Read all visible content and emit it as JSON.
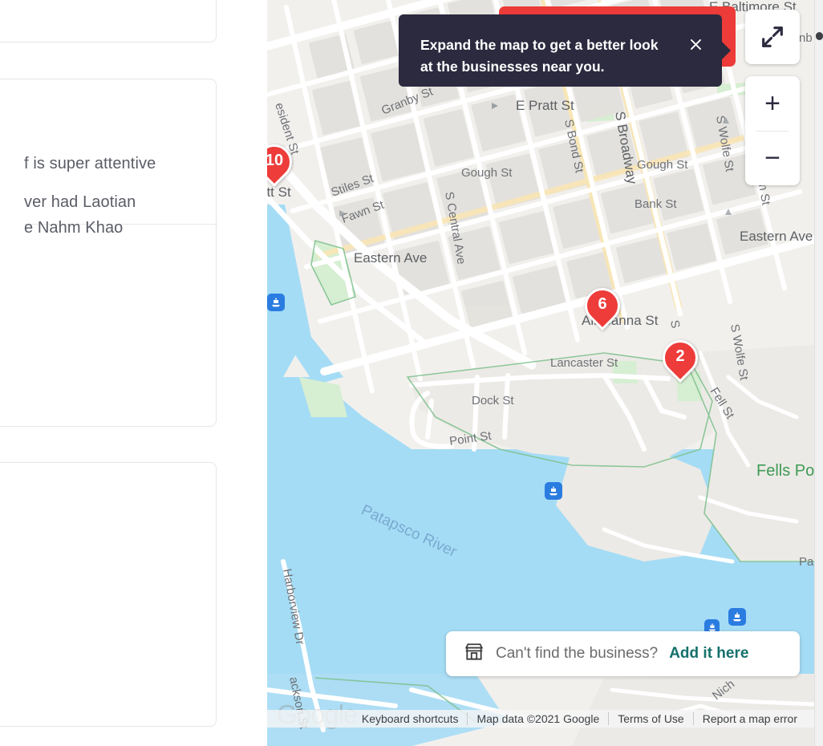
{
  "sidebar": {
    "cards": [
      {
        "id": "card-1",
        "text": ""
      },
      {
        "id": "card-2",
        "text": "f is super attentive"
      },
      {
        "id": "card-3",
        "text": "ver had Laotian\ne Nahm Khao"
      }
    ]
  },
  "tooltip": {
    "message": "Expand the map to get a better look at the businesses near you.",
    "close_icon": "close-icon"
  },
  "map_controls": {
    "expand_label": "expand-map",
    "expand_icon": "expand-arrows-icon",
    "zoom_in_label": "+",
    "zoom_out_label": "−"
  },
  "add_banner": {
    "icon": "storefront-icon",
    "prompt": "Can't find the business?",
    "link": "Add it here",
    "link_color": "#14706b"
  },
  "attribution": {
    "items": [
      "Keyboard shortcuts",
      "Map data ©2021 Google",
      "Terms of Use",
      "Report a map error"
    ]
  },
  "google_watermark": "Google",
  "map": {
    "markers": [
      {
        "id": "marker-10",
        "count": "10",
        "color": "#ed3c3a"
      },
      {
        "id": "marker-6",
        "count": "6",
        "color": "#ed3c3a"
      },
      {
        "id": "marker-2",
        "count": "2",
        "color": "#ed3c3a"
      }
    ],
    "transit_icons": [
      "ferry-icon",
      "ferry-icon",
      "ferry-icon",
      "ferry-icon"
    ],
    "street_labels": [
      "E Baltimore St",
      "E Pratt St",
      "Granby St",
      "Gough St",
      "Gough St",
      "Bank St",
      "S Bond St",
      "S Broadway",
      "S Wolfe St",
      "S Wolfe St",
      "President St",
      "Pratt St",
      "Stiles St",
      "Fawn St",
      "S Central Ave",
      "Eastern Ave",
      "Eastern Ave",
      "Aliceanna St",
      "Lancaster St",
      "Dock St",
      "Point St",
      "Fell St",
      "Harborview Dr",
      "Jackson St",
      "Nicholson St",
      "nb",
      "n St",
      "S "
    ],
    "place_labels": [
      "Fells Po",
      "Pa"
    ],
    "water_labels": [
      "Patapsco River"
    ],
    "colors": {
      "water": "#a5dcf5",
      "land": "#f1efec",
      "block": "#e7e5e1",
      "road": "#ffffff",
      "highlight_road": "#f8e6b5",
      "park": "#d3eed0",
      "marker": "#ed3c3a",
      "transit": "#2a7ce0",
      "park_label": "#3f9b56"
    }
  }
}
